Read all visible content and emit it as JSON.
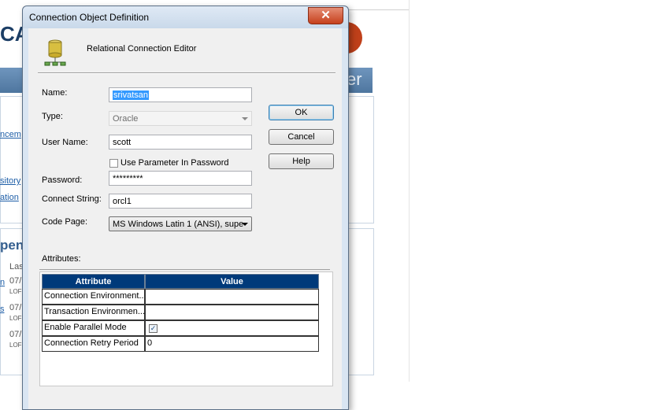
{
  "dialog": {
    "title": "Connection Object Definition",
    "close_glyph": "✕",
    "header": "Relational Connection Editor"
  },
  "form": {
    "name_label": "Name:",
    "name_value": "srivatsan",
    "type_label": "Type:",
    "type_value": "Oracle",
    "user_label": "User Name:",
    "user_value": "scott",
    "use_param_label": "Use Parameter In Password",
    "use_param_checked": false,
    "password_label": "Password:",
    "password_value": "*********",
    "connect_label": "Connect String:",
    "connect_value": "orcl1",
    "codepage_label": "Code Page:",
    "codepage_value": "MS Windows Latin 1 (ANSI), supe"
  },
  "buttons": {
    "ok": "OK",
    "cancel": "Cancel",
    "help": "Help"
  },
  "attributes": {
    "section_label": "Attributes:",
    "headers": [
      "Attribute",
      "Value"
    ],
    "rows": [
      {
        "name": "Connection Environment...",
        "value": ""
      },
      {
        "name": "Transaction Environmen...",
        "value": ""
      },
      {
        "name": "Enable Parallel Mode",
        "value": "",
        "checked": true
      },
      {
        "name": "Connection Retry Period",
        "value": "0"
      }
    ]
  },
  "background": {
    "logo_text": "CA",
    "bar_text": "er",
    "links": [
      "ncem",
      "sitory",
      "ation"
    ],
    "heading": "pen",
    "table_col": "Las",
    "cells": [
      "07/",
      "LOFI",
      "07/",
      "LOFI",
      "07/",
      "LOFI"
    ],
    "row_links": [
      "n",
      "s",
      ""
    ]
  },
  "colors": {
    "grid_header": "#003a7a",
    "dialog_frame": "#d9e5f2",
    "close_button": "#c6401c",
    "selection": "#3399ff"
  }
}
